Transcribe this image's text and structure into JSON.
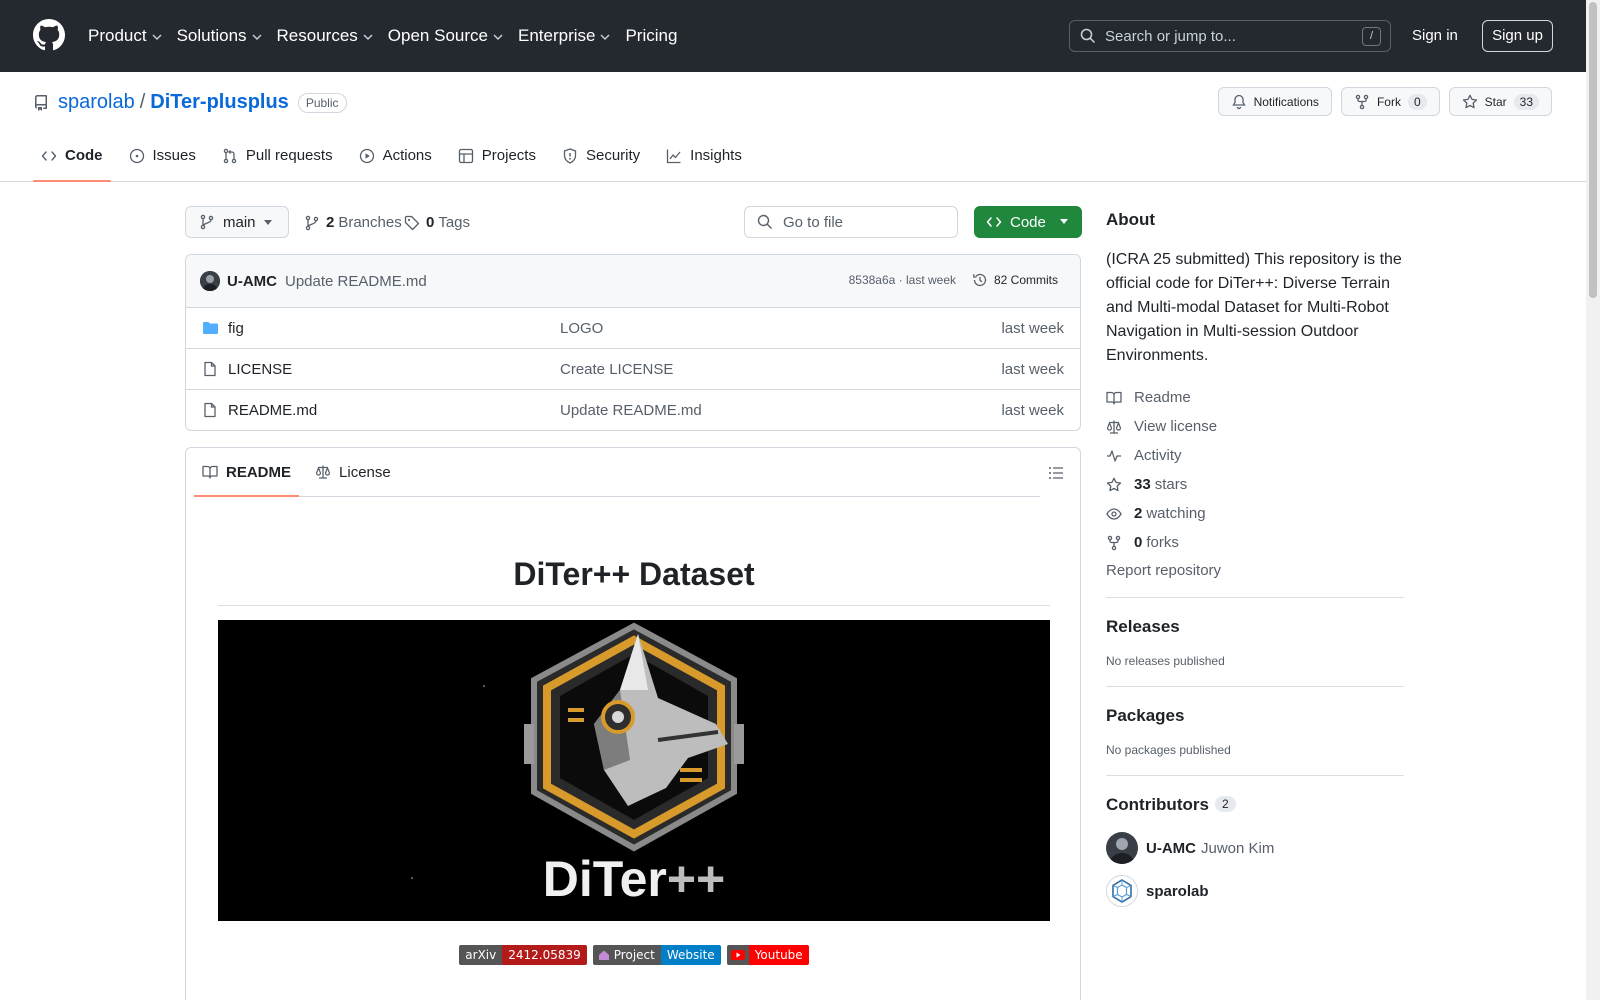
{
  "header": {
    "nav": [
      {
        "label": "Product",
        "has_menu": true
      },
      {
        "label": "Solutions",
        "has_menu": true
      },
      {
        "label": "Resources",
        "has_menu": true
      },
      {
        "label": "Open Source",
        "has_menu": true
      },
      {
        "label": "Enterprise",
        "has_menu": true
      },
      {
        "label": "Pricing",
        "has_menu": false
      }
    ],
    "search_placeholder": "Search or jump to...",
    "search_shortcut": "/",
    "sign_in": "Sign in",
    "sign_up": "Sign up"
  },
  "repo": {
    "owner": "sparolab",
    "separator": "/",
    "name": "DiTer-plusplus",
    "visibility": "Public",
    "notifications_label": "Notifications",
    "fork_label": "Fork",
    "fork_count": "0",
    "star_label": "Star",
    "star_count": "33",
    "tabs": [
      {
        "label": "Code",
        "icon": "code-icon",
        "active": true
      },
      {
        "label": "Issues",
        "icon": "issue-icon",
        "active": false
      },
      {
        "label": "Pull requests",
        "icon": "pull-request-icon",
        "active": false
      },
      {
        "label": "Actions",
        "icon": "play-icon",
        "active": false
      },
      {
        "label": "Projects",
        "icon": "table-icon",
        "active": false
      },
      {
        "label": "Security",
        "icon": "shield-icon",
        "active": false
      },
      {
        "label": "Insights",
        "icon": "graph-icon",
        "active": false
      }
    ]
  },
  "toolbar": {
    "branch": "main",
    "branches_count": "2",
    "branches_label": "Branches",
    "tags_count": "0",
    "tags_label": "Tags",
    "goto_placeholder": "Go to file",
    "code_button": "Code"
  },
  "commit": {
    "author": "U-AMC",
    "message": "Update README.md",
    "sha_time": "8538a6a · last week",
    "commits_label": "82 Commits"
  },
  "files": [
    {
      "name": "fig",
      "type": "folder",
      "message": "LOGO",
      "date": "last week"
    },
    {
      "name": "LICENSE",
      "type": "file",
      "message": "Create LICENSE",
      "date": "last week"
    },
    {
      "name": "README.md",
      "type": "file",
      "message": "Update README.md",
      "date": "last week"
    }
  ],
  "readme": {
    "tabs": [
      {
        "label": "README",
        "icon": "book-icon",
        "active": true
      },
      {
        "label": "License",
        "icon": "law-icon",
        "active": false
      }
    ],
    "title": "DiTer++ Dataset",
    "logo_text_main": "DiTer",
    "logo_text_suffix": "++",
    "badges": [
      {
        "left": "arXiv",
        "right": "2412.05839",
        "left_color": "#555555",
        "right_color": "#b31b1b"
      },
      {
        "left": "Project",
        "right": "Website",
        "left_color": "#555555",
        "right_color": "#007ec6",
        "icon": "home-icon"
      },
      {
        "left": "",
        "right": "Youtube",
        "left_color": "#555555",
        "right_color": "#ff0000",
        "icon": "youtube-icon"
      }
    ]
  },
  "about": {
    "heading": "About",
    "description": "(ICRA 25 submitted) This repository is the official code for DiTer++: Diverse Terrain and Multi-modal Dataset for Multi-Robot Navigation in Multi-session Outdoor Environments.",
    "links": [
      {
        "icon": "book-icon",
        "bold": "",
        "label": "Readme"
      },
      {
        "icon": "law-icon",
        "bold": "",
        "label": "View license"
      },
      {
        "icon": "pulse-icon",
        "bold": "",
        "label": "Activity"
      },
      {
        "icon": "star-icon",
        "bold": "33",
        "label": "stars"
      },
      {
        "icon": "eye-icon",
        "bold": "2",
        "label": "watching"
      },
      {
        "icon": "fork-icon",
        "bold": "0",
        "label": "forks"
      }
    ],
    "report": "Report repository"
  },
  "releases": {
    "heading": "Releases",
    "sub": "No releases published"
  },
  "packages": {
    "heading": "Packages",
    "sub": "No packages published"
  },
  "contributors": {
    "heading": "Contributors",
    "count": "2",
    "list": [
      {
        "login": "U-AMC",
        "name": "Juwon Kim"
      },
      {
        "login": "sparolab",
        "name": ""
      }
    ]
  },
  "colors": {
    "header_bg": "#24292f",
    "link": "#0969da",
    "primary_button": "#1f883d",
    "tab_underline": "#fd8c73",
    "muted_text": "#57606a"
  }
}
